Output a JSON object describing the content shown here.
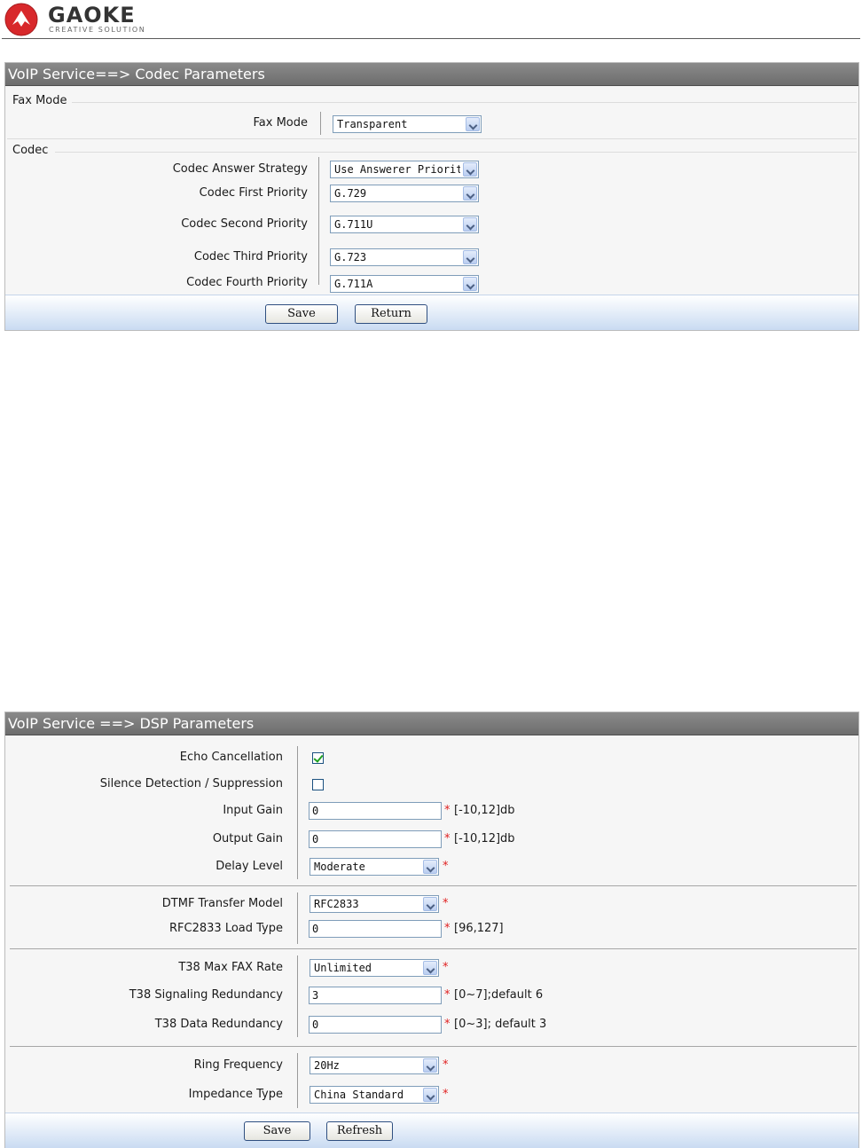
{
  "brand": {
    "name": "GAOKE",
    "tagline": "CREATIVE SOLUTION",
    "logo_color": "#d8282b"
  },
  "codec_panel": {
    "title": "VoIP Service==> Codec Parameters",
    "fax_section": {
      "heading": "Fax Mode",
      "fax_mode_label": "Fax Mode",
      "fax_mode_value": "Transparent"
    },
    "codec_section": {
      "heading": "Codec",
      "answer_strategy_label": "Codec Answer Strategy",
      "answer_strategy_value": "Use Answerer Priority",
      "first_priority_label": "Codec First Priority",
      "first_priority_value": "G.729",
      "second_priority_label": "Codec Second Priority",
      "second_priority_value": "G.711U",
      "third_priority_label": "Codec Third Priority",
      "third_priority_value": "G.723",
      "fourth_priority_label": "Codec Fourth Priority",
      "fourth_priority_value": "G.711A"
    },
    "buttons": {
      "save": "Save",
      "return": "Return"
    }
  },
  "dsp_panel": {
    "title": "VoIP Service ==> DSP Parameters",
    "echo_cancellation": {
      "label": "Echo Cancellation",
      "checked": true
    },
    "silence_detection": {
      "label": "Silence Detection / Suppression",
      "checked": false
    },
    "input_gain": {
      "label": "Input Gain",
      "value": "0",
      "hint": "[-10,12]db"
    },
    "output_gain": {
      "label": "Output Gain",
      "value": "0",
      "hint": "[-10,12]db"
    },
    "delay_level": {
      "label": "Delay Level",
      "value": "Moderate"
    },
    "dtmf_transfer_model": {
      "label": "DTMF Transfer Model",
      "value": "RFC2833"
    },
    "rfc2833_load_type": {
      "label": "RFC2833 Load Type",
      "value": "0",
      "hint": "[96,127]"
    },
    "t38_max_fax_rate": {
      "label": "T38 Max FAX Rate",
      "value": "Unlimited"
    },
    "t38_signaling_redundancy": {
      "label": "T38 Signaling Redundancy",
      "value": "3",
      "hint": "[0~7];default 6"
    },
    "t38_data_redundancy": {
      "label": "T38 Data Redundancy",
      "value": "0",
      "hint": "[0~3]; default 3"
    },
    "ring_frequency": {
      "label": "Ring Frequency",
      "value": "20Hz"
    },
    "impedance_type": {
      "label": "Impedance Type",
      "value": "China Standard"
    },
    "required_mark": "*",
    "buttons": {
      "save": "Save",
      "refresh": "Refresh"
    }
  }
}
